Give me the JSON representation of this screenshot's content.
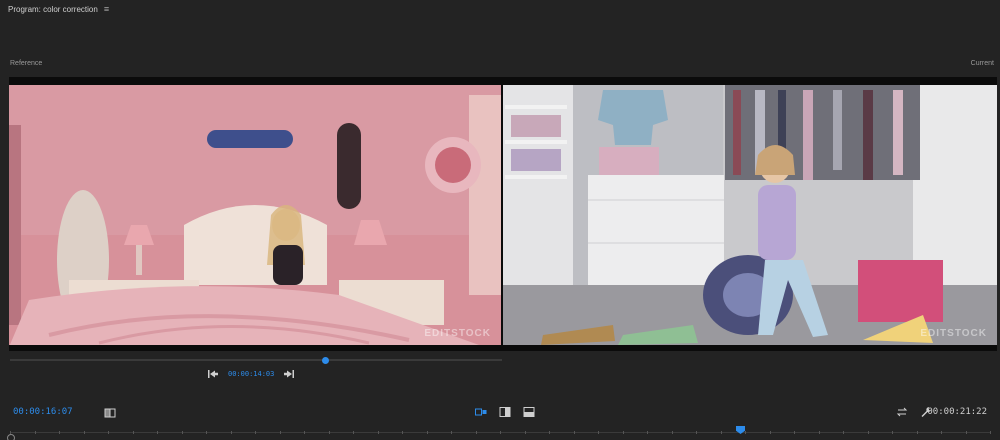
{
  "panel": {
    "title": "Program: color correction",
    "menu_icon": "hamburger-icon"
  },
  "comparison": {
    "left_label": "Reference",
    "right_label": "Current",
    "left_watermark": "EDITSTOCK",
    "right_watermark": "EDITSTOCK"
  },
  "reference_controls": {
    "timecode": "00:00:14:03",
    "scrub_position_percent": 64
  },
  "playback": {
    "current_timecode": "00:00:16:07",
    "duration_timecode": "00:00:21:22"
  },
  "colors": {
    "accent": "#2d8ceb",
    "background": "#232323"
  }
}
